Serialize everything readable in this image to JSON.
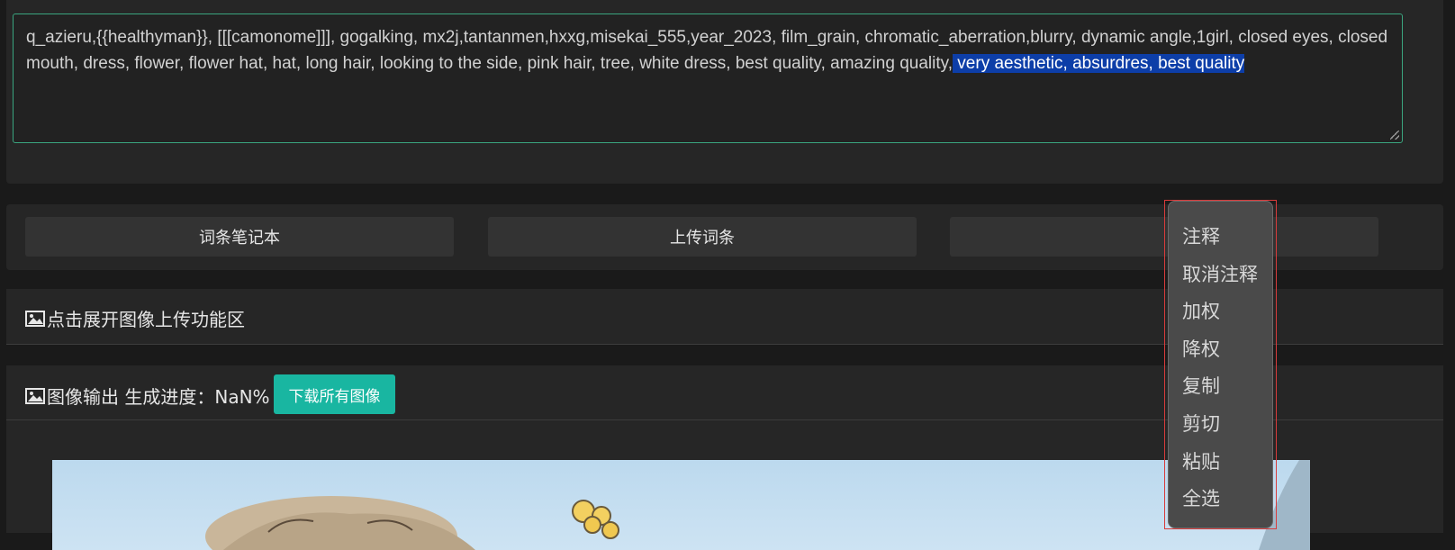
{
  "prompt": {
    "text_normal": "q_azieru,{{healthyman}}, [[[camonome]]], gogalking, mx2j,tantanmen,hxxg,misekai_555,year_2023, film_grain, chromatic_aberration,blurry, dynamic angle,1girl, closed eyes, closed mouth, dress, flower, flower hat, hat, long hair, looking to the side, pink hair, tree, white dress, best quality, amazing quality,",
    "text_selected": " very aesthetic, absurdres, best quality"
  },
  "buttons": {
    "notebook": "词条笔记本",
    "upload_terms": "上传词条",
    "third": ""
  },
  "upload_section": {
    "title": "点击展开图像上传功能区"
  },
  "output_section": {
    "title": "图像输出 生成进度：NaN%",
    "download_all": "下载所有图像"
  },
  "context_menu": {
    "items": [
      "注释",
      "取消注释",
      "加权",
      "降权",
      "复制",
      "剪切",
      "粘贴",
      "全选"
    ]
  },
  "colors": {
    "accent": "#19b6a1",
    "selection": "#0d3ea8",
    "focus_border": "#3aa57f",
    "menu_outline": "#d83b3b"
  }
}
